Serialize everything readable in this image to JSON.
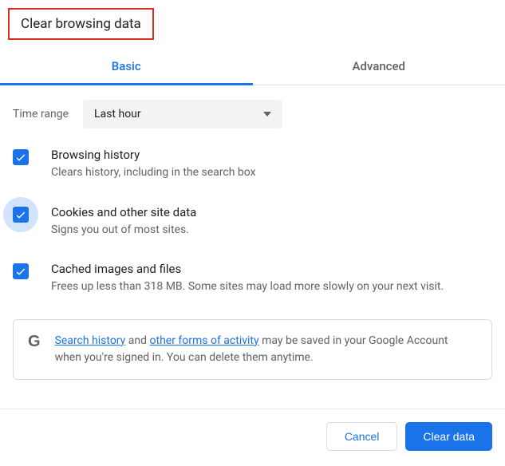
{
  "dialog": {
    "title": "Clear browsing data"
  },
  "tabs": {
    "basic": "Basic",
    "advanced": "Advanced"
  },
  "time_range": {
    "label": "Time range",
    "value": "Last hour"
  },
  "options": {
    "browsing": {
      "title": "Browsing history",
      "desc": "Clears history, including in the search box"
    },
    "cookies": {
      "title": "Cookies and other site data",
      "desc": "Signs you out of most sites."
    },
    "cache": {
      "title": "Cached images and files",
      "desc": "Frees up less than 318 MB. Some sites may load more slowly on your next visit."
    }
  },
  "info": {
    "link1": "Search history",
    "mid1": " and ",
    "link2": "other forms of activity",
    "rest": " may be saved in your Google Account when you're signed in. You can delete them anytime."
  },
  "buttons": {
    "cancel": "Cancel",
    "clear": "Clear data"
  }
}
